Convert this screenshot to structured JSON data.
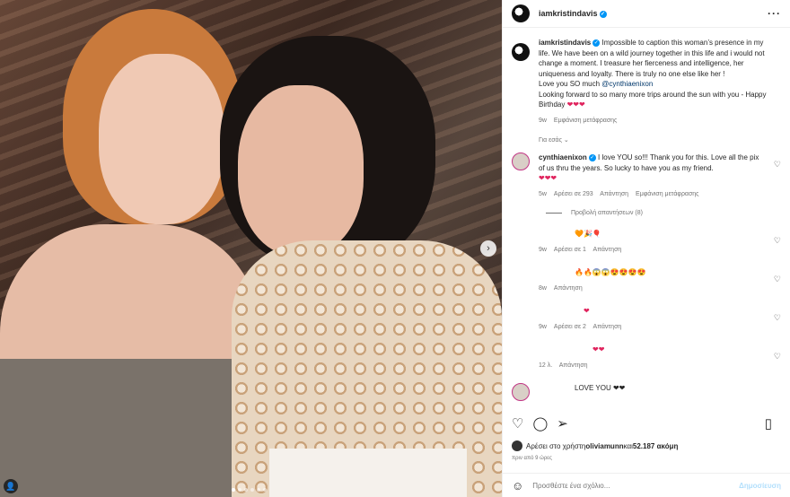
{
  "post": {
    "author": "iamkristindavis",
    "more_icon": "more-dots-icon",
    "caption_text": "Impossible to caption this woman’s presence in my life. We have been on a wild journey together in this life and i would not change a moment. I treasure her fierceness and intelligence, her uniqueness and loyalty. There is truly no one else like her !",
    "caption_line2_prefix": "Love you SO much ",
    "caption_mention": "@cynthiaenixon",
    "caption_line3": "Looking forward to so many more trips around the sun with you - Happy Birthday",
    "caption_hearts": "❤❤❤",
    "caption_time": "9w",
    "caption_translate": "Εμφάνιση μετάφρασης"
  },
  "for_you": "Για εσάς",
  "comments": [
    {
      "author": "cynthiaenixon",
      "text": "I love YOU so!!! Thank you for this. Love all the pix of us thru the years. So lucky to have you as my friend.",
      "hearts": "❤❤❤",
      "time": "5w",
      "likes": "Αρέσει σε 293",
      "reply": "Απάντηση",
      "translate": "Εμφάνιση μετάφρασης",
      "view_replies": "Προβολή απαντήσεων (8)"
    },
    {
      "author": "",
      "text": "🧡🎉🎈",
      "time": "9w",
      "likes": "Αρέσει σε 1",
      "reply": "Απάντηση"
    },
    {
      "author": "",
      "text": "🔥🔥😱😱😍😍😍😍",
      "time": "8w",
      "reply": "Απάντηση"
    },
    {
      "author": "",
      "text": "❤",
      "time": "9w",
      "likes": "Αρέσει σε 2",
      "reply": "Απάντηση"
    },
    {
      "author": "",
      "text": "❤❤",
      "time": "12 λ.",
      "reply": "Απάντηση"
    },
    {
      "author": "",
      "text": "LOVE YOU ❤❤"
    }
  ],
  "likes": {
    "prefix": "Αρέσει στο χρήστη ",
    "user": "oliviamunn",
    "mid": " και ",
    "count": "52.187 ακόμη"
  },
  "time_ago": "πριν από 9 ώρες",
  "add_comment": {
    "placeholder": "Προσθέστε ένα σχόλιο...",
    "post_label": "Δημοσίευση"
  },
  "icons": {
    "like": "heart-outline-icon",
    "comment": "comment-icon",
    "share": "share-icon",
    "save": "bookmark-icon",
    "emoji": "emoji-icon"
  }
}
